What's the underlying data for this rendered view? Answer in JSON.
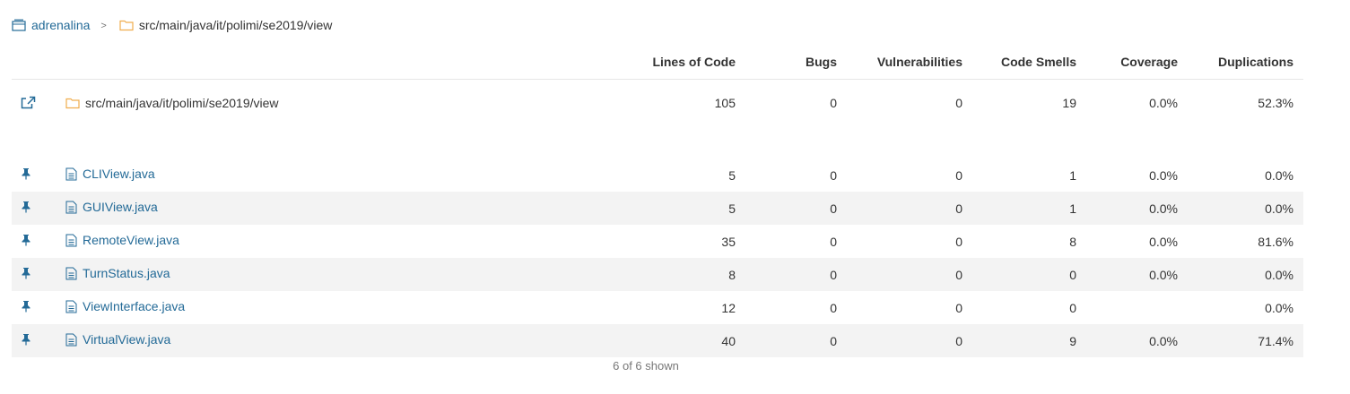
{
  "breadcrumb": {
    "project": "adrenalina",
    "path": "src/main/java/it/polimi/se2019/view",
    "separator": ">"
  },
  "columns": {
    "lines_of_code": "Lines of Code",
    "bugs": "Bugs",
    "vulnerabilities": "Vulnerabilities",
    "code_smells": "Code Smells",
    "coverage": "Coverage",
    "duplications": "Duplications"
  },
  "base": {
    "name": "src/main/java/it/polimi/se2019/view",
    "lines_of_code": "105",
    "bugs": "0",
    "vulnerabilities": "0",
    "code_smells": "19",
    "coverage": "0.0%",
    "duplications": "52.3%"
  },
  "files": [
    {
      "name": "CLIView.java",
      "lines_of_code": "5",
      "bugs": "0",
      "vulnerabilities": "0",
      "code_smells": "1",
      "coverage": "0.0%",
      "duplications": "0.0%"
    },
    {
      "name": "GUIView.java",
      "lines_of_code": "5",
      "bugs": "0",
      "vulnerabilities": "0",
      "code_smells": "1",
      "coverage": "0.0%",
      "duplications": "0.0%"
    },
    {
      "name": "RemoteView.java",
      "lines_of_code": "35",
      "bugs": "0",
      "vulnerabilities": "0",
      "code_smells": "8",
      "coverage": "0.0%",
      "duplications": "81.6%"
    },
    {
      "name": "TurnStatus.java",
      "lines_of_code": "8",
      "bugs": "0",
      "vulnerabilities": "0",
      "code_smells": "0",
      "coverage": "0.0%",
      "duplications": "0.0%"
    },
    {
      "name": "ViewInterface.java",
      "lines_of_code": "12",
      "bugs": "0",
      "vulnerabilities": "0",
      "code_smells": "0",
      "coverage": "",
      "duplications": "0.0%"
    },
    {
      "name": "VirtualView.java",
      "lines_of_code": "40",
      "bugs": "0",
      "vulnerabilities": "0",
      "code_smells": "9",
      "coverage": "0.0%",
      "duplications": "71.4%"
    }
  ],
  "footer": {
    "shown": "6 of 6 shown"
  },
  "colors": {
    "link": "#236a97",
    "folder": "#f0ad4e",
    "row_alt": "#f3f3f3"
  },
  "icons": {
    "project": "project-icon",
    "folder": "folder-icon",
    "file": "file-icon",
    "open": "open-new-window-icon",
    "pin": "pin-icon"
  }
}
